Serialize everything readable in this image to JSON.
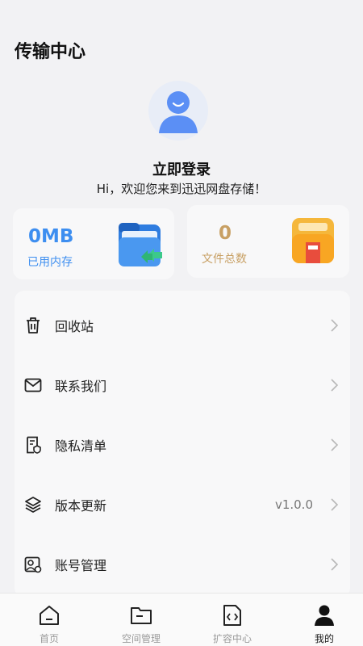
{
  "header": {
    "title": "传输中心"
  },
  "profile": {
    "login_label": "立即登录",
    "welcome_text": "Hi，欢迎您来到迅迅网盘存储！"
  },
  "stats": {
    "used": {
      "value": "0MB",
      "label": "已用内存"
    },
    "files": {
      "value": "0",
      "label": "文件总数"
    }
  },
  "menu": {
    "items": [
      {
        "label": "回收站",
        "value": ""
      },
      {
        "label": "联系我们",
        "value": ""
      },
      {
        "label": "隐私清单",
        "value": ""
      },
      {
        "label": "版本更新",
        "value": "v1.0.0"
      },
      {
        "label": "账号管理",
        "value": ""
      }
    ]
  },
  "tabbar": {
    "tabs": [
      {
        "label": "首页"
      },
      {
        "label": "空间管理"
      },
      {
        "label": "扩容中心"
      },
      {
        "label": "我的"
      }
    ],
    "active": "我的"
  },
  "colors": {
    "used_accent": "#3d8ef0",
    "files_accent": "#c8a064"
  }
}
